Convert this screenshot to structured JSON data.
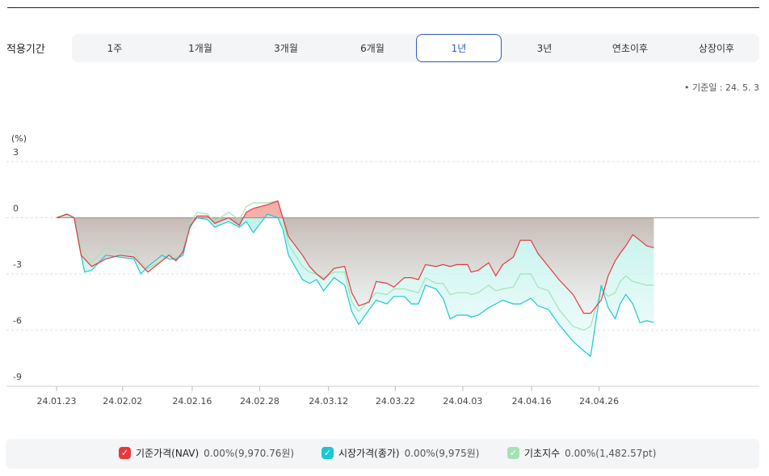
{
  "period": {
    "label": "적용기간",
    "options": [
      "1주",
      "1개월",
      "3개월",
      "6개월",
      "1년",
      "3년",
      "연초이후",
      "상장이후"
    ],
    "selected_index": 4
  },
  "base_date": "• 기준일 : 24. 5. 3",
  "colors": {
    "nav": "#e8383d",
    "market": "#1cc7d0",
    "index": "#a4e2b6",
    "accent": "#2f57c4"
  },
  "chart_data": {
    "type": "line",
    "unit_label": "(%)",
    "ylim": [
      -9,
      3
    ],
    "yticks": [
      3,
      0,
      -3,
      -6,
      -9
    ],
    "xticks": [
      "24.01.23",
      "24.02.02",
      "24.02.16",
      "24.02.28",
      "24.03.12",
      "24.03.22",
      "24.04.03",
      "24.04.16",
      "24.04.26"
    ],
    "grid": true,
    "x_index_range": [
      0,
      100
    ],
    "tick_positions": [
      0,
      9.4,
      19.3,
      28.9,
      38.7,
      48.2,
      57.8,
      67.6,
      77.2
    ],
    "series": [
      {
        "name": "기준가격(NAV)",
        "color": "#e8383d",
        "points": [
          [
            0,
            0
          ],
          [
            1.5,
            0.2
          ],
          [
            2.5,
            0
          ],
          [
            3.5,
            -2
          ],
          [
            5,
            -2.6
          ],
          [
            7,
            -2.2
          ],
          [
            9,
            -2
          ],
          [
            11,
            -2.1
          ],
          [
            12,
            -2.5
          ],
          [
            13,
            -2.9
          ],
          [
            15,
            -2.3
          ],
          [
            16,
            -2
          ],
          [
            17,
            -2.3
          ],
          [
            18,
            -1.8
          ],
          [
            19,
            -0.5
          ],
          [
            20,
            0.1
          ],
          [
            21.5,
            0.1
          ],
          [
            22.5,
            -0.3
          ],
          [
            24.5,
            0
          ],
          [
            26,
            -0.4
          ],
          [
            27,
            0.3
          ],
          [
            28,
            0.5
          ],
          [
            30,
            0.7
          ],
          [
            31.5,
            0.9
          ],
          [
            32.2,
            0
          ],
          [
            33,
            -1
          ],
          [
            35,
            -2
          ],
          [
            36,
            -2.6
          ],
          [
            37,
            -3
          ],
          [
            38,
            -3.3
          ],
          [
            39.5,
            -2.7
          ],
          [
            41,
            -2.6
          ],
          [
            42,
            -4
          ],
          [
            43,
            -4.7
          ],
          [
            44.5,
            -4.5
          ],
          [
            45.5,
            -3.4
          ],
          [
            47,
            -3.5
          ],
          [
            48,
            -3.7
          ],
          [
            49.5,
            -3.2
          ],
          [
            50.5,
            -3.2
          ],
          [
            51.5,
            -3.3
          ],
          [
            52.5,
            -2.5
          ],
          [
            54,
            -2.6
          ],
          [
            55,
            -2.5
          ],
          [
            56,
            -2.6
          ],
          [
            57,
            -2.5
          ],
          [
            58.5,
            -2.5
          ],
          [
            59,
            -2.9
          ],
          [
            60,
            -2.8
          ],
          [
            61.5,
            -2.4
          ],
          [
            62.5,
            -3.1
          ],
          [
            63.5,
            -2.5
          ],
          [
            65,
            -2.1
          ],
          [
            66,
            -1.2
          ],
          [
            67.5,
            -1.2
          ],
          [
            68.5,
            -1.9
          ],
          [
            70,
            -2.6
          ],
          [
            71.5,
            -3.3
          ],
          [
            73.5,
            -4.1
          ],
          [
            75,
            -5.1
          ],
          [
            76,
            -5.1
          ],
          [
            77.5,
            -4.4
          ],
          [
            78.5,
            -3.1
          ],
          [
            79.5,
            -2.3
          ],
          [
            80.2,
            -1.9
          ],
          [
            81,
            -1.5
          ],
          [
            82,
            -0.9
          ],
          [
            83,
            -1.2
          ],
          [
            84,
            -1.5
          ],
          [
            85,
            -1.6
          ]
        ]
      },
      {
        "name": "시장가격(종가)",
        "color": "#1cc7d0",
        "points": [
          [
            0,
            0
          ],
          [
            1.5,
            0.2
          ],
          [
            2.5,
            0
          ],
          [
            3.5,
            -2
          ],
          [
            4,
            -2.9
          ],
          [
            5,
            -2.8
          ],
          [
            7,
            -2
          ],
          [
            9,
            -2.1
          ],
          [
            11,
            -2.2
          ],
          [
            12,
            -3
          ],
          [
            13,
            -2.6
          ],
          [
            15,
            -2
          ],
          [
            16,
            -2.2
          ],
          [
            17,
            -2.2
          ],
          [
            18,
            -2
          ],
          [
            19,
            -0.4
          ],
          [
            20,
            0
          ],
          [
            21.5,
            -0.1
          ],
          [
            22.5,
            -0.5
          ],
          [
            24.5,
            -0.2
          ],
          [
            26,
            -0.5
          ],
          [
            27,
            -0.2
          ],
          [
            28,
            -0.8
          ],
          [
            30,
            0.2
          ],
          [
            31.5,
            0
          ],
          [
            32.2,
            -0.6
          ],
          [
            33,
            -2
          ],
          [
            35,
            -3.3
          ],
          [
            36,
            -3.5
          ],
          [
            37,
            -3.3
          ],
          [
            38,
            -3.9
          ],
          [
            39.5,
            -3.2
          ],
          [
            41,
            -3.6
          ],
          [
            42,
            -5
          ],
          [
            43,
            -5.7
          ],
          [
            44.5,
            -4.9
          ],
          [
            45.5,
            -4.4
          ],
          [
            47,
            -4.6
          ],
          [
            48,
            -4.2
          ],
          [
            49.5,
            -4.2
          ],
          [
            50.5,
            -4.6
          ],
          [
            51.5,
            -4.6
          ],
          [
            52.5,
            -3.6
          ],
          [
            54,
            -3.8
          ],
          [
            55,
            -4.3
          ],
          [
            56,
            -5.4
          ],
          [
            57,
            -5.2
          ],
          [
            58.5,
            -5.2
          ],
          [
            59,
            -5.3
          ],
          [
            60,
            -5.2
          ],
          [
            61.5,
            -4.8
          ],
          [
            62.5,
            -4.6
          ],
          [
            63.5,
            -4.4
          ],
          [
            65,
            -4.6
          ],
          [
            66,
            -4.6
          ],
          [
            67.5,
            -4.3
          ],
          [
            68.5,
            -4.7
          ],
          [
            70,
            -4.9
          ],
          [
            71.5,
            -5.7
          ],
          [
            73.5,
            -6.6
          ],
          [
            75,
            -7.1
          ],
          [
            76,
            -7.4
          ],
          [
            77.5,
            -3.6
          ],
          [
            78.5,
            -4.8
          ],
          [
            79.5,
            -5.4
          ],
          [
            80.2,
            -4.6
          ],
          [
            81,
            -4.1
          ],
          [
            82,
            -4.6
          ],
          [
            83,
            -5.6
          ],
          [
            84,
            -5.5
          ],
          [
            85,
            -5.6
          ]
        ]
      },
      {
        "name": "기초지수",
        "color": "#a4e2b6",
        "points": [
          [
            0,
            0
          ],
          [
            1.5,
            0.2
          ],
          [
            2.5,
            0
          ],
          [
            3.5,
            -1.6
          ],
          [
            5,
            -2.4
          ],
          [
            7,
            -1.6
          ],
          [
            9,
            -1.8
          ],
          [
            11,
            -1.8
          ],
          [
            12,
            -2.4
          ],
          [
            13,
            -2.7
          ],
          [
            15,
            -2.3
          ],
          [
            16,
            -1.9
          ],
          [
            17,
            -2.1
          ],
          [
            18,
            -1.9
          ],
          [
            19,
            -0.3
          ],
          [
            20,
            0.3
          ],
          [
            21.5,
            0.2
          ],
          [
            22.5,
            -0.2
          ],
          [
            24.5,
            0.3
          ],
          [
            26,
            -0.1
          ],
          [
            27,
            0.6
          ],
          [
            28,
            0.8
          ],
          [
            30,
            0.8
          ],
          [
            31.5,
            0.9
          ],
          [
            32.2,
            0
          ],
          [
            33,
            -1.4
          ],
          [
            35,
            -2.6
          ],
          [
            36,
            -2.9
          ],
          [
            37,
            -3
          ],
          [
            38,
            -3.2
          ],
          [
            39.5,
            -2.9
          ],
          [
            41,
            -2.9
          ],
          [
            42,
            -4.5
          ],
          [
            43,
            -5
          ],
          [
            44.5,
            -4.4
          ],
          [
            45.5,
            -4
          ],
          [
            47,
            -4.1
          ],
          [
            48,
            -3.8
          ],
          [
            49.5,
            -3.8
          ],
          [
            50.5,
            -3.9
          ],
          [
            51.5,
            -4
          ],
          [
            52.5,
            -3.2
          ],
          [
            54,
            -3.5
          ],
          [
            55,
            -3.5
          ],
          [
            56,
            -4.1
          ],
          [
            57,
            -4
          ],
          [
            58.5,
            -4
          ],
          [
            59,
            -4.1
          ],
          [
            60,
            -4
          ],
          [
            61.5,
            -3.6
          ],
          [
            62.5,
            -3.9
          ],
          [
            63.5,
            -3.8
          ],
          [
            65,
            -3.7
          ],
          [
            66,
            -3
          ],
          [
            67.5,
            -3
          ],
          [
            68.5,
            -3.7
          ],
          [
            70,
            -3.9
          ],
          [
            71.5,
            -4.9
          ],
          [
            73.5,
            -5.8
          ],
          [
            75,
            -6
          ],
          [
            76,
            -5.8
          ],
          [
            77.5,
            -3.8
          ],
          [
            78.5,
            -4.2
          ],
          [
            79.5,
            -4
          ],
          [
            80.2,
            -3.4
          ],
          [
            81,
            -3.1
          ],
          [
            82,
            -3.4
          ],
          [
            83,
            -3.5
          ],
          [
            84,
            -3.6
          ],
          [
            85,
            -3.6
          ]
        ]
      }
    ]
  },
  "legend": [
    {
      "name": "기준가격(NAV)",
      "value": "0.00%(9,970.76원)",
      "color": "#e8383d"
    },
    {
      "name": "시장가격(종가)",
      "value": "0.00%(9,975원)",
      "color": "#1cc7d0"
    },
    {
      "name": "기초지수",
      "value": "0.00%(1,482.57pt)",
      "color": "#a4e2b6"
    }
  ]
}
